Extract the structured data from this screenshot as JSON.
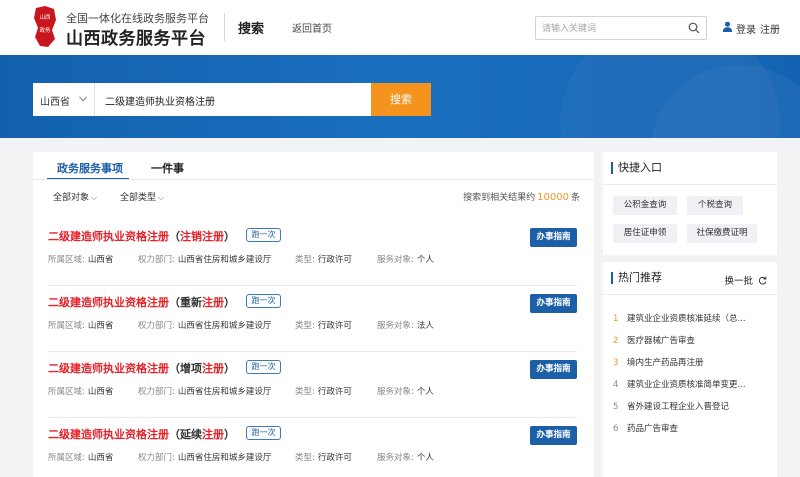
{
  "header": {
    "logo_text": "山西政务",
    "brand_sub": "全国一体化在线政务服务平台",
    "brand_main": "山西政务服务平台",
    "nav_search": "搜索",
    "nav_home": "返回首页",
    "search_placeholder": "请输入关键词",
    "login": "登录",
    "register": "注册"
  },
  "banner": {
    "region": "山西省",
    "query": "二级建造师执业资格注册",
    "search_button": "搜索"
  },
  "tabs": [
    {
      "label": "政务服务事项",
      "active": true
    },
    {
      "label": "一件事",
      "active": false
    }
  ],
  "filters": [
    {
      "label": "全部对象"
    },
    {
      "label": "全部类型"
    }
  ],
  "result_count": {
    "prefix": "搜索到相关结果约",
    "count": "10000",
    "suffix": "条"
  },
  "meta_labels": {
    "area": "所属区域:",
    "dept": "权力部门:",
    "type": "类型:",
    "target": "服务对象:"
  },
  "results": [
    {
      "title_main": "二级建造师执业资格注册",
      "paren_open": "（",
      "paren_red": "注销注册",
      "paren_close": "）",
      "badge": "跑一次",
      "area": "山西省",
      "dept": "山西省住房和城乡建设厅",
      "type": "行政许可",
      "target": "个人",
      "guide": "办事指南"
    },
    {
      "title_main": "二级建造师执业资格注册",
      "paren_open": "（重新",
      "paren_red": "注册",
      "paren_close": "）",
      "badge": "跑一次",
      "area": "山西省",
      "dept": "山西省住房和城乡建设厅",
      "type": "行政许可",
      "target": "法人",
      "guide": "办事指南"
    },
    {
      "title_main": "二级建造师执业资格注册",
      "paren_open": "（增项",
      "paren_red": "注册",
      "paren_close": "）",
      "badge": "跑一次",
      "area": "山西省",
      "dept": "山西省住房和城乡建设厅",
      "type": "行政许可",
      "target": "个人",
      "guide": "办事指南"
    },
    {
      "title_main": "二级建造师执业资格注册",
      "paren_open": "（延续",
      "paren_red": "注册",
      "paren_close": "）",
      "badge": "跑一次",
      "area": "山西省",
      "dept": "山西省住房和城乡建设厅",
      "type": "行政许可",
      "target": "个人",
      "guide": "办事指南"
    }
  ],
  "quick_entry": {
    "title": "快捷入口",
    "items": [
      "公积金查询",
      "个税查询",
      "居住证申领",
      "社保缴费证明"
    ]
  },
  "hot": {
    "title": "热门推荐",
    "refresh": "换一批",
    "items": [
      {
        "num": "1",
        "label": "建筑业企业资质核准延续（总..."
      },
      {
        "num": "2",
        "label": "医疗器械广告审查"
      },
      {
        "num": "3",
        "label": "境内生产药品再注册"
      },
      {
        "num": "4",
        "label": "建筑业企业资质核准简单变更..."
      },
      {
        "num": "5",
        "label": "省外建设工程企业入晋登记"
      },
      {
        "num": "6",
        "label": "药品广告审查"
      }
    ]
  },
  "colors": {
    "primary": "#1d5fa6",
    "accent": "#f5931f",
    "highlight": "#e4232a",
    "logo": "#c8161d"
  }
}
